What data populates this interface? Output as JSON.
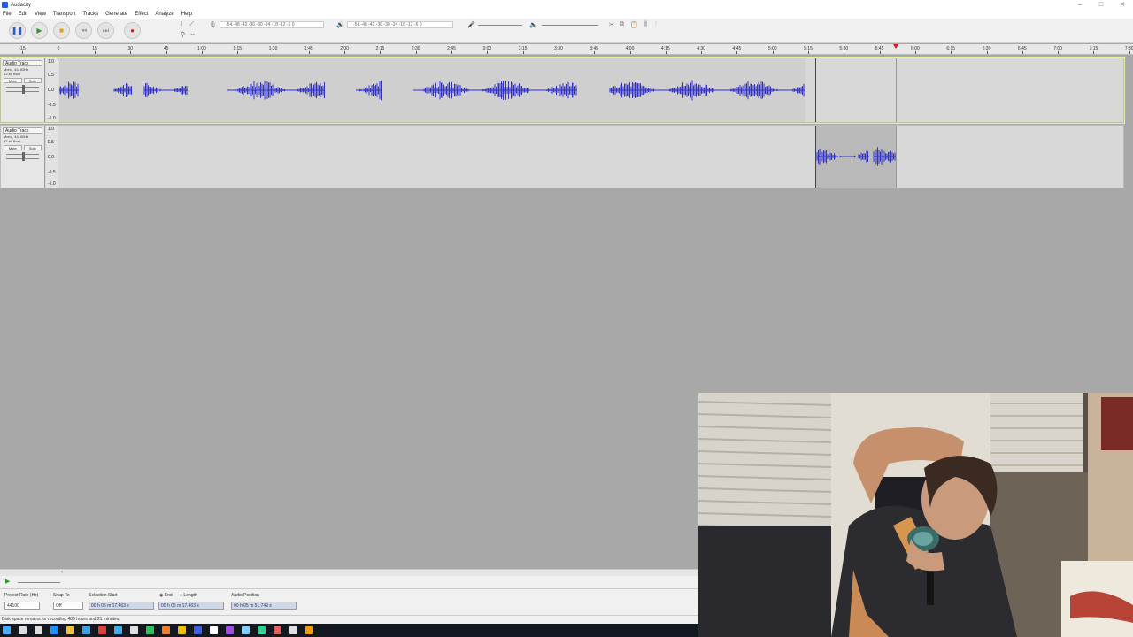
{
  "window": {
    "title": "Audacity",
    "controls": [
      "–",
      "□",
      "✕"
    ]
  },
  "menu": [
    "File",
    "Edit",
    "View",
    "Transport",
    "Tracks",
    "Generate",
    "Effect",
    "Analyze",
    "Help"
  ],
  "toolbar": {
    "pause_glyph": "❚❚",
    "play_glyph": "▶",
    "stop_glyph": "■",
    "skipstart_glyph": "⏮",
    "skipend_glyph": "⏭",
    "record_glyph": "●",
    "meter_record_scale": "-54 -48 -42 -36 -30 -24 -18 -12 -6 0",
    "meter_play_scale": "-54 -48 -42 -36 -30 -24 -18 -12 -6 0"
  },
  "ruler": {
    "ticks": [
      "-15",
      "15",
      "30",
      "45",
      "1:00",
      "1:15",
      "1:30",
      "1:45",
      "2:00",
      "2:15",
      "2:30",
      "2:45",
      "3:00",
      "3:15",
      "3:30",
      "3:45",
      "4:00",
      "4:15",
      "4:30",
      "4:45",
      "5:00",
      "5:15",
      "5:30",
      "5:45",
      "6:00",
      "6:15",
      "6:30",
      "6:45",
      "7:00",
      "7:15",
      "7:30"
    ],
    "zero_label": "0"
  },
  "tracks": [
    {
      "name": "Audio Track",
      "info1": "Mono, 44100Hz",
      "info2": "32-bit float",
      "mute": "Mute",
      "solo": "Solo",
      "scale": [
        "1.0",
        "0.5",
        "0.0",
        "-0.5",
        "-1.0"
      ],
      "clip_end_time": "5:06"
    },
    {
      "name": "Audio Track",
      "info1": "Mono, 44100Hz",
      "info2": "32-bit float",
      "mute": "Mute",
      "solo": "Solo",
      "scale": [
        "1.0",
        "0.5",
        "0.0",
        "-0.5",
        "-1.0"
      ],
      "clip_start_time": "5:10",
      "clip_end_time": "5:43"
    }
  ],
  "selection": {
    "project_rate_label": "Project Rate (Hz)",
    "project_rate_value": "44100",
    "snap_to_label": "Snap-To",
    "snap_to_value": "Off",
    "selection_start_label": "Selection Start",
    "end_label": "End",
    "length_label": "Length",
    "audio_position_label": "Audio Position",
    "selection_start_value": "00 h 05 m 17.463 s",
    "selection_end_value": "00 h 05 m 17.463 s",
    "audio_position_value": "00 h 05 m 51.749 s"
  },
  "status": {
    "text": "Disk space remains for recording 486 hours and 21 minutes."
  },
  "colors": {
    "waveform": "#3232c8",
    "track_bg": "#d8d8d8",
    "selected_outline": "#e6ef9c",
    "taskbar": "#14181f"
  },
  "taskbar": {
    "icons": [
      "windows-icon",
      "search-icon",
      "task-view-icon",
      "edge-icon",
      "file-explorer-icon",
      "store-icon",
      "chrome-icon",
      "app-icon",
      "app-icon",
      "app-icon",
      "app-icon",
      "app-icon",
      "app-icon",
      "app-icon",
      "app-icon",
      "app-icon",
      "app-icon",
      "app-icon",
      "app-icon",
      "audacity-icon"
    ]
  }
}
